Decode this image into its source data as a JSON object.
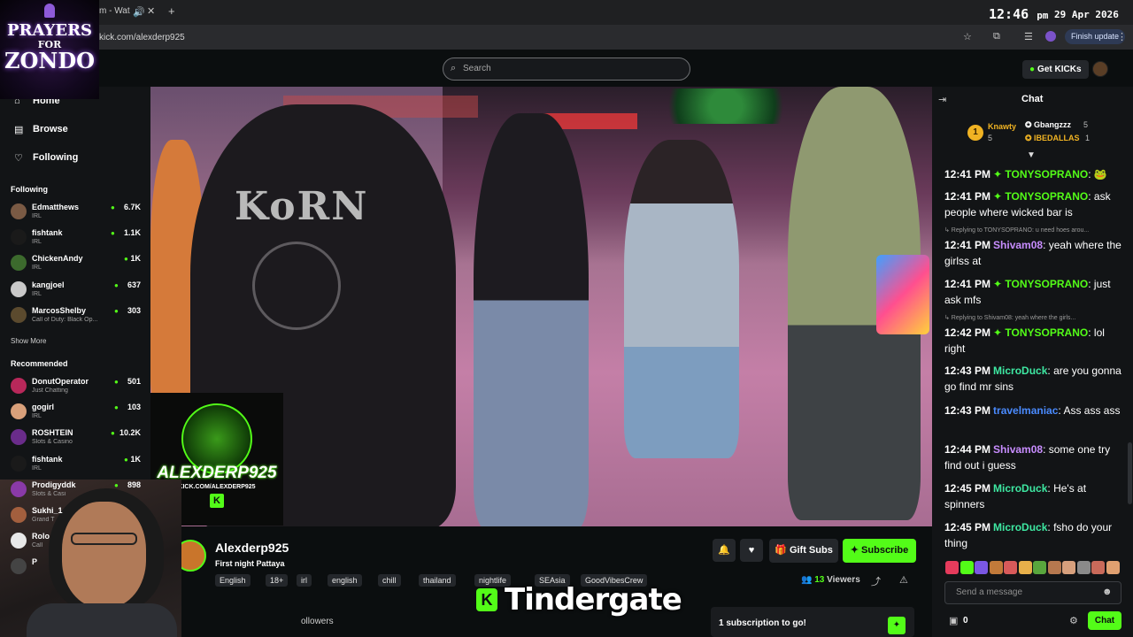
{
  "browser": {
    "tab_title": "m - Wat",
    "url": "kick.com/alexderp925",
    "finish_update": "Finish update",
    "clock_time": "12:46",
    "clock_ampm": "pm",
    "clock_date": "29 Apr 2026"
  },
  "header": {
    "search_placeholder": "Search",
    "get_kicks": "Get KICKs"
  },
  "overlay": {
    "logo_line1": "PRAYERS",
    "logo_line2": "FOR",
    "logo_line3": "ZONDO",
    "alex_logo": "ALEXDERP925",
    "alex_url": "KICK.COM/ALEXDERP925",
    "caption": "Tindergate"
  },
  "sidebar": {
    "nav": [
      {
        "label": "Home",
        "icon": "home-icon"
      },
      {
        "label": "Browse",
        "icon": "browse-icon"
      },
      {
        "label": "Following",
        "icon": "heart-icon"
      }
    ],
    "following_title": "Following",
    "following": [
      {
        "name": "Edmatthews",
        "category": "IRL",
        "viewers": "6.7K",
        "color": "#7a5a44"
      },
      {
        "name": "fishtank",
        "category": "IRL",
        "viewers": "1.1K",
        "color": "#1a1a1a"
      },
      {
        "name": "ChickenAndy",
        "category": "IRL",
        "viewers": "1K",
        "color": "#3c6a2d"
      },
      {
        "name": "kangjoel",
        "category": "IRL",
        "viewers": "637",
        "color": "#c9c9c9"
      },
      {
        "name": "MarcosShelby",
        "category": "Call of Duty: Black Op...",
        "viewers": "303",
        "color": "#5b4a2e"
      }
    ],
    "show_more": "Show More",
    "recommended_title": "Recommended",
    "recommended": [
      {
        "name": "DonutOperator",
        "category": "Just Chatting",
        "viewers": "501",
        "color": "#b8285a"
      },
      {
        "name": "gogirl",
        "category": "IRL",
        "viewers": "103",
        "color": "#d9a07a"
      },
      {
        "name": "ROSHTEIN",
        "category": "Slots & Casino",
        "viewers": "10.2K",
        "color": "#6a2c8a"
      },
      {
        "name": "fishtank",
        "category": "IRL",
        "viewers": "1K",
        "color": "#1a1a1a"
      },
      {
        "name": "Prodigyddk",
        "category": "Slots & Casi",
        "viewers": "898",
        "color": "#8a3aa8"
      },
      {
        "name": "Sukhi_1",
        "category": "Grand T",
        "viewers": "",
        "color": "#a35f3e"
      },
      {
        "name": "Rolo",
        "category": "Call",
        "viewers": "",
        "color": "#e8e8e8"
      },
      {
        "name": "P",
        "category": "",
        "viewers": "",
        "color": "#444"
      }
    ]
  },
  "stream": {
    "name": "Alexderp925",
    "title": "First night Pattaya",
    "tags": [
      "English",
      "18+",
      "irl",
      "english",
      "chill",
      "thailand",
      "nightlife",
      "SEAsia",
      "GoodVibesCrew"
    ],
    "viewers_count": "13",
    "viewers_label": "Viewers",
    "followers": "ollowers",
    "gift_subs": "Gift Subs",
    "subscribe": "Subscribe",
    "sub_goal": "1 subscription to go!"
  },
  "chat": {
    "title": "Chat",
    "top_gifters": [
      {
        "rank": "1",
        "name": "Knawty",
        "count": "5"
      },
      {
        "name": "Gbangzzz",
        "count": "5"
      },
      {
        "name": "IBEDALLAS",
        "count": "1"
      }
    ],
    "messages": [
      {
        "time": "12:41 PM",
        "user": "TONYSOPRANO",
        "color": "#53fc18",
        "text": "",
        "verified": true,
        "reply": ""
      },
      {
        "time": "12:41 PM",
        "user": "TONYSOPRANO",
        "color": "#53fc18",
        "text": "ask people where wicked bar is",
        "verified": true,
        "reply": ""
      },
      {
        "time": "12:41 PM",
        "user": "Shivam08",
        "color": "#c88dff",
        "text": "yeah where the girlss at",
        "verified": false,
        "reply": "Replying to TONYSOPRANO: u need hoes arou..."
      },
      {
        "time": "12:41 PM",
        "user": "TONYSOPRANO",
        "color": "#53fc18",
        "text": "just ask mfs",
        "verified": true,
        "reply": ""
      },
      {
        "time": "12:42 PM",
        "user": "TONYSOPRANO",
        "color": "#53fc18",
        "text": "lol right",
        "verified": true,
        "reply": "Replying to Shivam08: yeah where the girls..."
      },
      {
        "time": "12:43 PM",
        "user": "MicroDuck",
        "color": "#3ee8a2",
        "text": "are you gonna go find mr sins",
        "verified": false,
        "reply": ""
      },
      {
        "time": "12:43 PM",
        "user": "travelmaniac",
        "color": "#4a8bff",
        "text": "Ass ass ass",
        "verified": false,
        "reply": ""
      },
      {
        "time": "12:44 PM",
        "user": "Shivam08",
        "color": "#c88dff",
        "text": "some one try find out i guess",
        "verified": false,
        "reply": ""
      },
      {
        "time": "12:45 PM",
        "user": "MicroDuck",
        "color": "#3ee8a2",
        "text": "He's at spinners",
        "verified": false,
        "reply": ""
      },
      {
        "time": "12:45 PM",
        "user": "MicroDuck",
        "color": "#3ee8a2",
        "text": "fsho do your thing",
        "verified": false,
        "reply": ""
      }
    ],
    "input_placeholder": "Send a message",
    "kicks_count": "0",
    "send_label": "Chat"
  }
}
